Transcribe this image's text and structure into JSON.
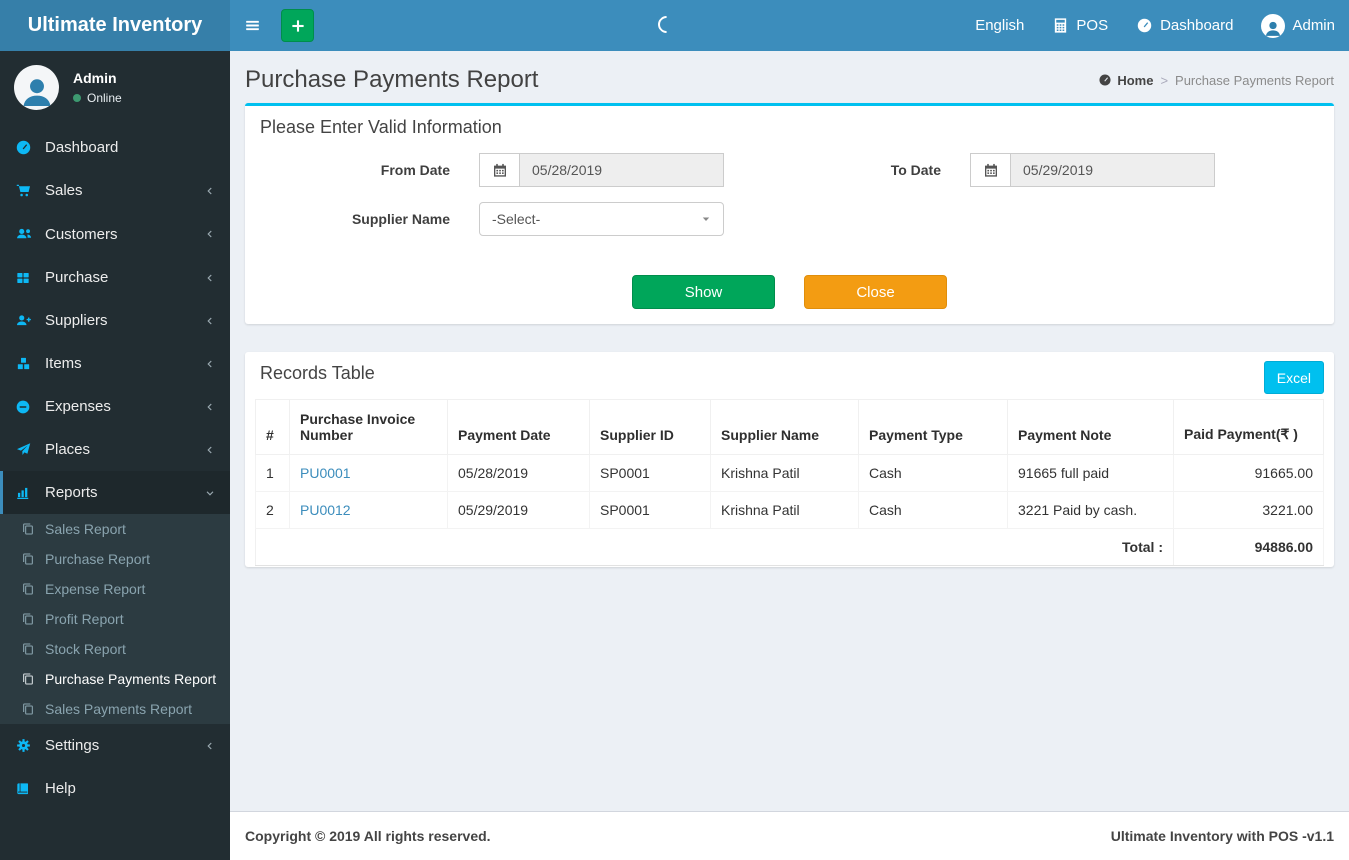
{
  "app": {
    "brand": "Ultimate Inventory",
    "footer_left": "Copyright © 2019 All rights reserved.",
    "footer_right": "Ultimate Inventory with POS -v1.1"
  },
  "header": {
    "language": "English",
    "pos_label": "POS",
    "dashboard_label": "Dashboard",
    "user_label": "Admin"
  },
  "user_panel": {
    "name": "Admin",
    "status": "Online"
  },
  "sidebar": {
    "items": [
      {
        "label": "Dashboard"
      },
      {
        "label": "Sales"
      },
      {
        "label": "Customers"
      },
      {
        "label": "Purchase"
      },
      {
        "label": "Suppliers"
      },
      {
        "label": "Items"
      },
      {
        "label": "Expenses"
      },
      {
        "label": "Places"
      },
      {
        "label": "Reports"
      },
      {
        "label": "Settings"
      },
      {
        "label": "Help"
      }
    ],
    "reports_submenu": [
      "Sales Report",
      "Purchase Report",
      "Expense Report",
      "Profit Report",
      "Stock Report",
      "Purchase Payments Report",
      "Sales Payments Report"
    ]
  },
  "page": {
    "title": "Purchase Payments Report",
    "breadcrumb_home": "Home",
    "breadcrumb_current": "Purchase Payments Report"
  },
  "filter": {
    "panel_title": "Please Enter Valid Information",
    "from_date_label": "From Date",
    "from_date_value": "05/28/2019",
    "to_date_label": "To Date",
    "to_date_value": "05/29/2019",
    "supplier_label": "Supplier Name",
    "supplier_value": "-Select-",
    "show_label": "Show",
    "close_label": "Close"
  },
  "records": {
    "panel_title": "Records Table",
    "excel_label": "Excel",
    "columns": [
      "#",
      "Purchase Invoice Number",
      "Payment Date",
      "Supplier ID",
      "Supplier Name",
      "Payment Type",
      "Payment Note",
      "Paid Payment(₹ )"
    ],
    "rows": [
      {
        "index": "1",
        "invoice": "PU0001",
        "date": "05/28/2019",
        "supplier_id": "SP0001",
        "supplier_name": "Krishna Patil",
        "type": "Cash",
        "note": "91665 full paid",
        "paid": "91665.00"
      },
      {
        "index": "2",
        "invoice": "PU0012",
        "date": "05/29/2019",
        "supplier_id": "SP0001",
        "supplier_name": "Krishna Patil",
        "type": "Cash",
        "note": "3221 Paid by cash.",
        "paid": "3221.00"
      }
    ],
    "total_label": "Total :",
    "total_value": "94886.00"
  },
  "colors": {
    "navbar": "#3c8dbc",
    "logo_bg": "#367fa9",
    "sidebar_bg": "#222d32",
    "submenu_bg": "#2c3b41",
    "sidebar_icon": "#0db8f5",
    "panel_accent": "#00c0ef",
    "show_button": "#00a65a",
    "close_button": "#f39c12",
    "excel_button": "#00c0ef",
    "add_button": "#00a65a",
    "link": "#3c8dbc",
    "content_bg": "#ecf0f5"
  }
}
